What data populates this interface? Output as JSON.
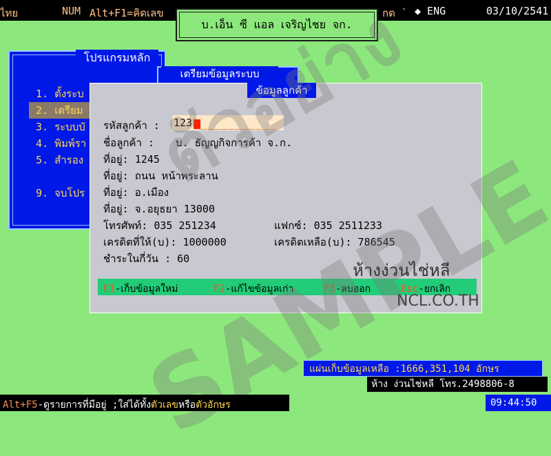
{
  "topbar": {
    "lang": "ไทย",
    "num": "NUM",
    "hotkey": "Alt+F1=คิดเลข",
    "mode": "กด `",
    "kb": "◆ ENG",
    "date": "03/10/2541"
  },
  "company": "บ.เอ็น ซี แอล เจริญไชย จก.",
  "main_menu": {
    "title": "โปรแกรมหลัก",
    "items": [
      {
        "label": "1. ตั้งระบ"
      },
      {
        "label": "2. เตรียม"
      },
      {
        "label": "3. ระบบบั"
      },
      {
        "label": "4. พิมพ์รา"
      },
      {
        "label": "5. สำรอง"
      },
      {
        "label": "9. จบโปร"
      }
    ]
  },
  "sub_window": {
    "title": "เตรียมข้อมูลระบบ"
  },
  "customer": {
    "title": "ข้อมูลลูกค้า",
    "code_label": "รหัสลูกค้า  :",
    "code_value": "123",
    "code_blank": "___________",
    "name_label": "ชื่อลูกค้า  :",
    "name_value": "บ. ธัญญกิจการค้า จ.ก.",
    "addr1": "ที่อยู่: 1245",
    "addr2": "ที่อยู่: ถนน หน้าพระลาน",
    "addr3": "ที่อยู่: อ.เมือง",
    "addr4": "ที่อยู่: จ.อยุธยา 13000",
    "phone": "โทรศัพท์: 035 251234",
    "fax": "แฟกซ์: 035 2511233",
    "credit_given": "เครดิตที่ให้(บ): 1000000",
    "credit_left": "เครดิตเหลือ(บ):     786545",
    "pay_days": "ชำระในกี่วัน   : 60"
  },
  "fkeys": [
    {
      "key": "F1",
      "label": "-เก็บข้อมูลใหม่"
    },
    {
      "key": "F2",
      "label": "-แก้ไขข้อมูลเก่า"
    },
    {
      "key": "F3",
      "label": "-ลบออก"
    },
    {
      "key": "Esc",
      "label": "-ยกเลิก"
    }
  ],
  "watermark": {
    "thai": "ตัวอย่าง",
    "sample": "SAMPLE",
    "shop": "ห้างง่วนไช่หลี",
    "site": "NCL.CO.TH"
  },
  "disk_info": "แผ่นเก็บข้อมูลเหลือ :1666,351,104 อักษร",
  "shop_info": "ห้าง ง่วนไช่หลี โทร.2498806-8",
  "bottom": {
    "key": "Alt+F5",
    "text1": "-ดูรายการที่มีอยู่ ;ใส่ได้ทั้ง",
    "digit": "ตัวเลข",
    "or": "หรือ",
    "letter": "ตัวอักษร"
  },
  "clock": "09:44:50"
}
